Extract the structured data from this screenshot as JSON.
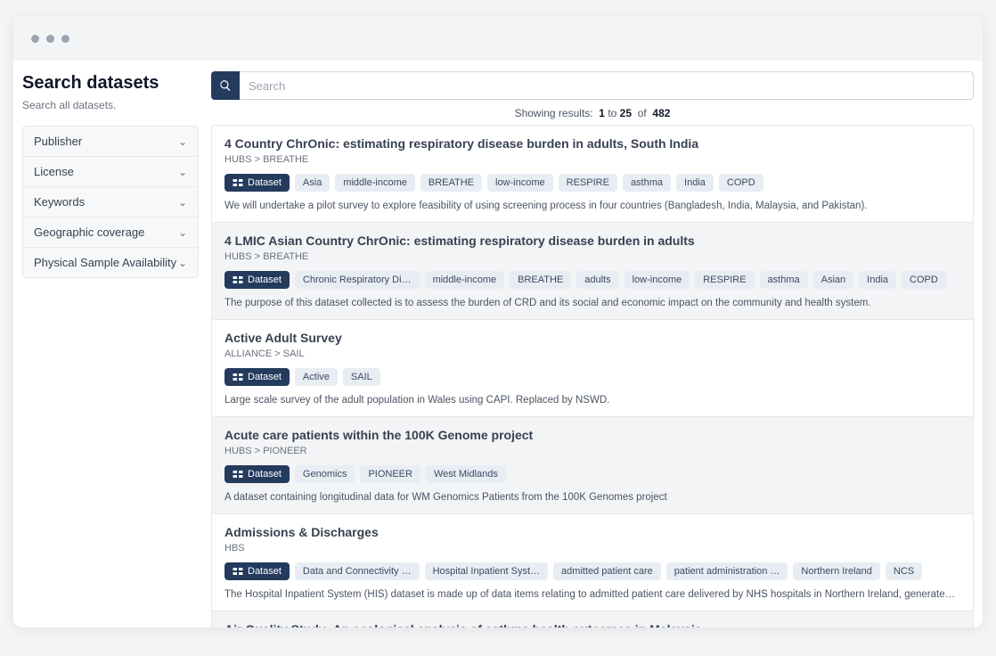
{
  "sidebar": {
    "title": "Search datasets",
    "subtitle": "Search all datasets.",
    "filters": [
      {
        "label": "Publisher"
      },
      {
        "label": "License"
      },
      {
        "label": "Keywords"
      },
      {
        "label": "Geographic coverage"
      },
      {
        "label": "Physical Sample Availability"
      }
    ]
  },
  "search": {
    "placeholder": "Search"
  },
  "meta": {
    "prefix": "Showing results:",
    "from": "1",
    "mid": "to",
    "to": "25",
    "of_word": "of",
    "total": "482"
  },
  "dataset_label": "Dataset",
  "rows": [
    {
      "title": "4 Country ChrOnic: estimating respiratory disease burden in adults, South India",
      "crumb": "HUBS > BREATHE",
      "tags": [
        "Asia",
        "middle-income",
        "BREATHE",
        "low-income",
        "RESPIRE",
        "asthma",
        "India",
        "COPD"
      ],
      "desc": "We will undertake a pilot survey to explore feasibility of using screening process in four countries (Bangladesh, India, Malaysia, and Pakistan)."
    },
    {
      "title": "4 LMIC Asian Country ChrOnic: estimating respiratory disease burden in adults",
      "crumb": "HUBS > BREATHE",
      "tags": [
        "Chronic Respiratory Di…",
        "middle-income",
        "BREATHE",
        "adults",
        "low-income",
        "RESPIRE",
        "asthma",
        "Asian",
        "India",
        "COPD"
      ],
      "desc": "The purpose of this dataset collected is to assess the burden of CRD and its social and economic impact on the community and health system."
    },
    {
      "title": "Active Adult Survey",
      "crumb": "ALLIANCE > SAIL",
      "tags": [
        "Active",
        "SAIL"
      ],
      "desc": "Large scale survey of the adult population in Wales using CAPI. Replaced by NSWD."
    },
    {
      "title": "Acute care patients within the 100K Genome project",
      "crumb": "HUBS > PIONEER",
      "tags": [
        "Genomics",
        "PIONEER",
        "West Midlands"
      ],
      "desc": "A dataset containing longitudinal data for WM Genomics Patients from the 100K Genomes project"
    },
    {
      "title": "Admissions & Discharges",
      "crumb": "HBS",
      "tags": [
        "Data and Connectivity …",
        "Hospital Inpatient Syst…",
        "admitted patient care",
        "patient administration …",
        "Northern Ireland",
        "NCS"
      ],
      "desc": "The Hospital Inpatient System (HIS) dataset is made up of data items relating to admitted patient care delivered by NHS hospitals in Northern Ireland, generated by the patient administration systems within each hos…"
    },
    {
      "title": "Air Quality Study: An ecological analysis of asthma health outcomes in Malaysia",
      "crumb": "",
      "tags": [],
      "desc": ""
    }
  ]
}
